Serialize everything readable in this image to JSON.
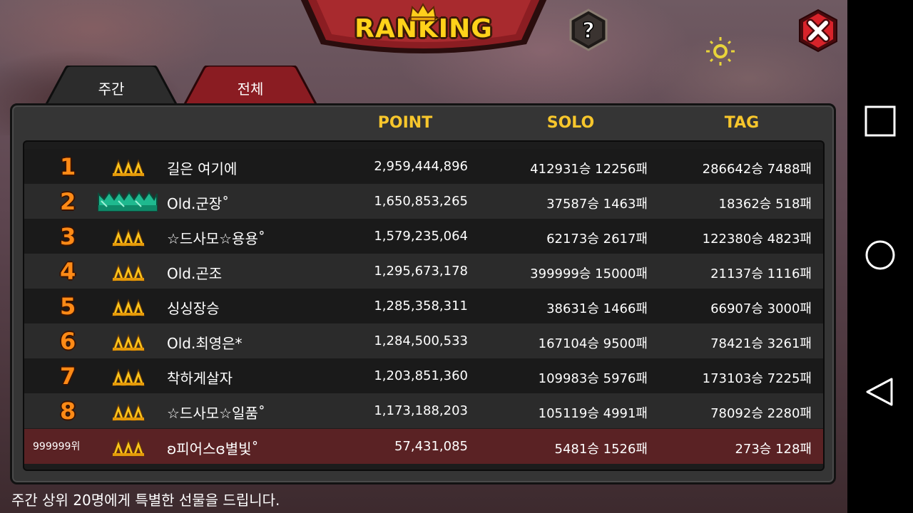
{
  "header": {
    "title": "RANKING",
    "crown_icon": "crown-icon",
    "help_label": "?",
    "close_icon": "close-x-icon",
    "brightness_icon": "sun-icon"
  },
  "tabs": [
    {
      "label": "주간",
      "active": true
    },
    {
      "label": "전체",
      "active": false
    }
  ],
  "columns": {
    "point": "POINT",
    "solo": "SOLO",
    "tag": "TAG"
  },
  "rows": [
    {
      "rank": "1",
      "badge": "triple-chevron-gold-icon",
      "name": "길은 여기에",
      "point": "2,959,444,896",
      "solo": "412931승 12256패",
      "tag": "286642승 7488패"
    },
    {
      "rank": "2",
      "badge": "crown-emerald-icon",
      "name": "Old.군장˚",
      "point": "1,650,853,265",
      "solo": "37587승 1463패",
      "tag": "18362승 518패"
    },
    {
      "rank": "3",
      "badge": "triple-chevron-gold-icon",
      "name": "☆드사모☆용용˚",
      "point": "1,579,235,064",
      "solo": "62173승 2617패",
      "tag": "122380승 4823패"
    },
    {
      "rank": "4",
      "badge": "triple-chevron-gold-icon",
      "name": "Old.곤조",
      "point": "1,295,673,178",
      "solo": "399999승 15000패",
      "tag": "21137승 1116패"
    },
    {
      "rank": "5",
      "badge": "triple-chevron-gold-icon",
      "name": "싱싱장승",
      "point": "1,285,358,311",
      "solo": "38631승 1466패",
      "tag": "66907승 3000패"
    },
    {
      "rank": "6",
      "badge": "triple-chevron-gold-icon",
      "name": "Old.최영은*",
      "point": "1,284,500,533",
      "solo": "167104승 9500패",
      "tag": "78421승 3261패"
    },
    {
      "rank": "7",
      "badge": "triple-chevron-gold-icon",
      "name": "착하게살자",
      "point": "1,203,851,360",
      "solo": "109983승 5976패",
      "tag": "173103승 7225패"
    },
    {
      "rank": "8",
      "badge": "triple-chevron-gold-icon",
      "name": "☆드사모☆일품˚",
      "point": "1,173,188,203",
      "solo": "105119승 4991패",
      "tag": "78092승 2280패"
    }
  ],
  "my_row": {
    "rank": "999999위",
    "badge": "triple-chevron-gold-icon",
    "name": "ʚ피어스ɞ별빛˚",
    "point": "57,431,085",
    "solo": "5481승 1526패",
    "tag": "273승 128패"
  },
  "footer": "주간 상위 20명에게 특별한 선물을 드립니다.",
  "android_nav": [
    "recents-square-icon",
    "home-circle-icon",
    "back-triangle-icon"
  ],
  "colors": {
    "accent_gold": "#f7c62c",
    "rank_orange": "#ff8a16",
    "close_red": "#d8232a",
    "tab_red": "#8a1c22",
    "my_row": "#5a2224"
  }
}
